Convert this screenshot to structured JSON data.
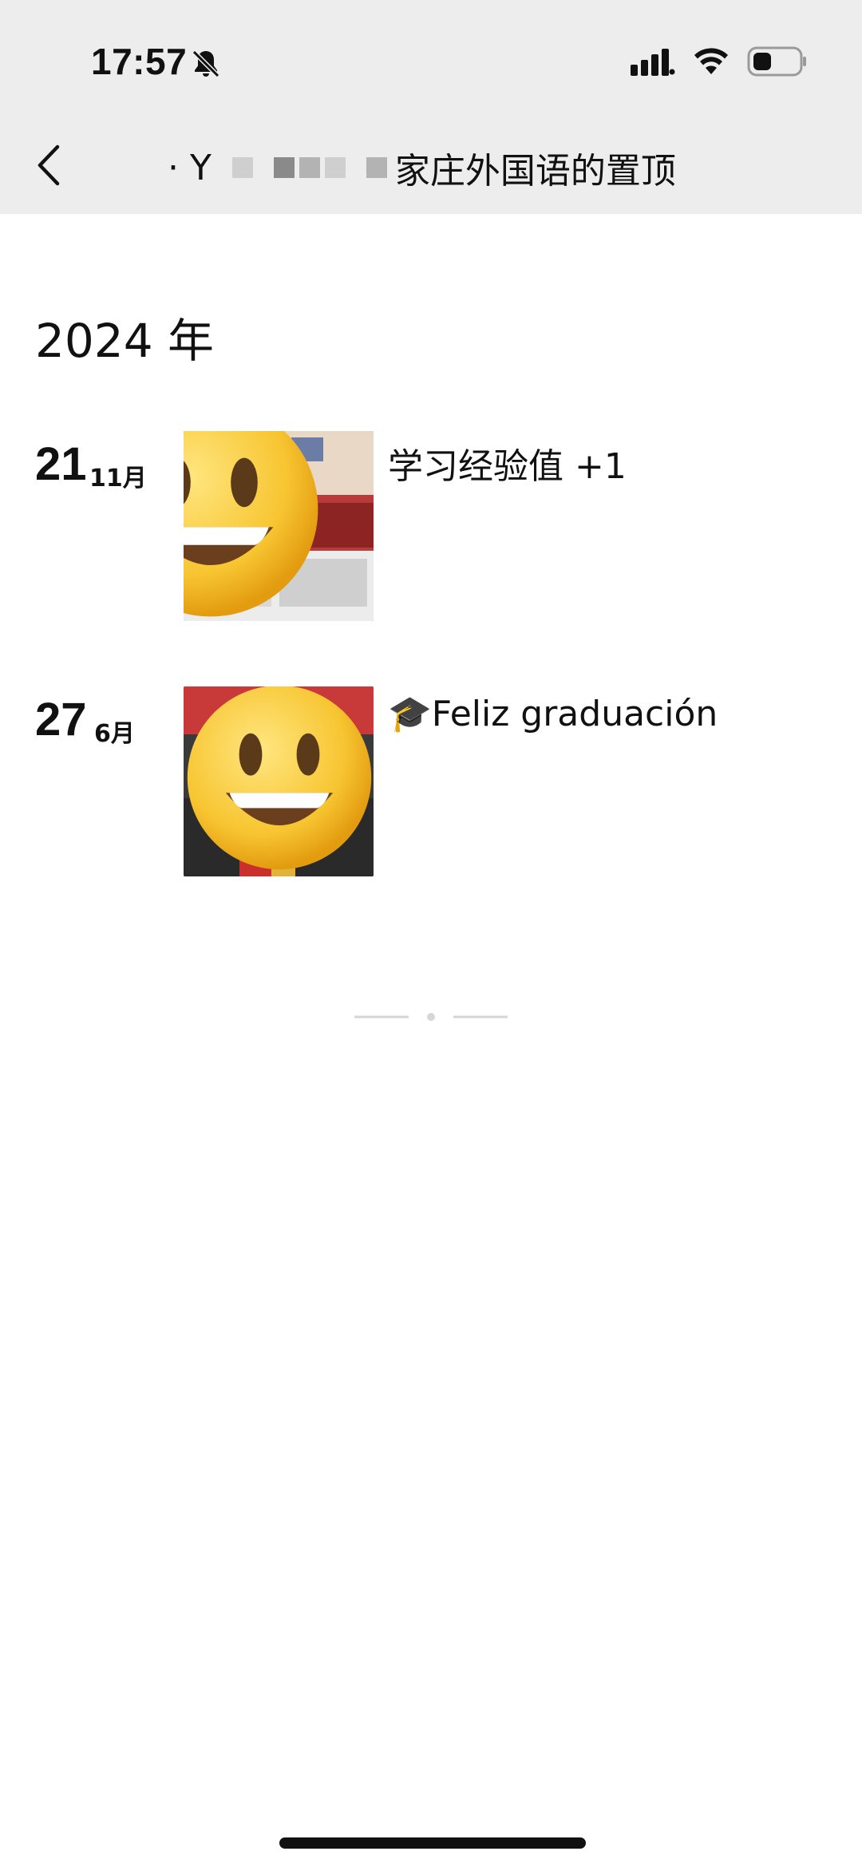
{
  "status_bar": {
    "time": "17:57",
    "icons": [
      "bell-muted-icon",
      "cellular-signal-icon",
      "wifi-icon",
      "battery-icon"
    ]
  },
  "nav": {
    "back_icon": "chevron-left-icon",
    "title_visible_start": "· Y",
    "title_visible_end": "家庄外国语的置顶"
  },
  "timeline": {
    "year": "2024 年",
    "posts": [
      {
        "day": "21",
        "month": "11月",
        "caption": "学习经验值 +1",
        "thumb": "photo-collage"
      },
      {
        "day": "27",
        "month": "6月",
        "caption": "🎓Feliz graduación",
        "thumb": "graduation-photo"
      }
    ]
  },
  "colors": {
    "header_bg": "#ededed",
    "page_bg": "#ffffff",
    "text": "#111111",
    "divider": "#d6d6d6"
  }
}
